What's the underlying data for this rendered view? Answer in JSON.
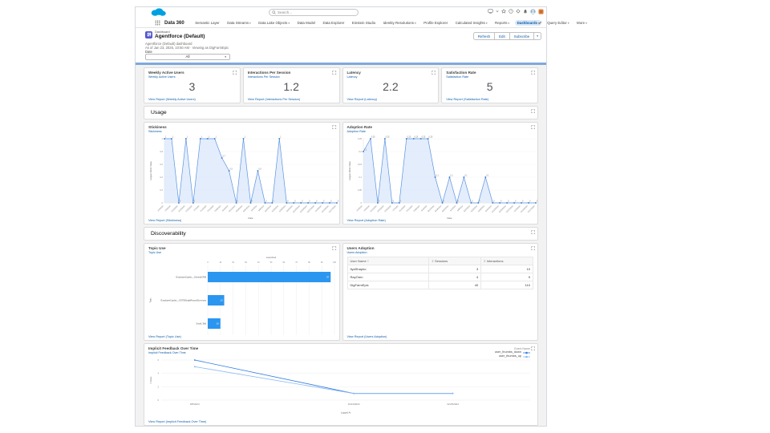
{
  "topbar": {
    "app_name": "Data 360",
    "search_placeholder": "Search...",
    "nav_items": [
      {
        "label": "Semantic Layer",
        "caret": false,
        "active": false
      },
      {
        "label": "Data Streams",
        "caret": true,
        "active": false
      },
      {
        "label": "Data Lake Objects",
        "caret": true,
        "active": false
      },
      {
        "label": "Data Model",
        "caret": false,
        "active": false
      },
      {
        "label": "Data Explorer",
        "caret": false,
        "active": false
      },
      {
        "label": "Einstein Studio",
        "caret": false,
        "active": false
      },
      {
        "label": "Identity Resolutions",
        "caret": true,
        "active": false
      },
      {
        "label": "Profile Explorer",
        "caret": false,
        "active": false
      },
      {
        "label": "Calculated Insights",
        "caret": true,
        "active": false
      },
      {
        "label": "Reports",
        "caret": true,
        "active": false
      },
      {
        "label": "Dashboards",
        "caret": true,
        "active": true
      },
      {
        "label": "Query Editor",
        "caret": true,
        "active": false
      },
      {
        "label": "More",
        "caret": true,
        "active": false
      }
    ],
    "icons": [
      "screenshot-icon",
      "chevron-down-icon",
      "favorites-icon",
      "help-icon",
      "setup-icon",
      "notifications-icon",
      "user-avatar",
      "astro-icon"
    ]
  },
  "header": {
    "type_label": "Dashboard",
    "title": "Agentforce (Default)",
    "subtitle": "Agentforce (Default) dashboard",
    "as_of": "As of Jan 23, 2025, 10:50 AM · Viewing as DigFarmEpic",
    "actions": [
      "Refresh",
      "Edit",
      "Subscribe"
    ],
    "filter": {
      "label": "Date",
      "value": "All"
    }
  },
  "sections": {
    "usage": "Usage",
    "discoverability": "Discoverability"
  },
  "metrics": [
    {
      "title": "Weekly Active Users",
      "subtitle": "Weekly Active Users",
      "value": "3",
      "link": "View Report (Weekly Active Users)"
    },
    {
      "title": "Interactions Per Session",
      "subtitle": "Interactions Per Session",
      "value": "1.2",
      "link": "View Report (Interactions Per Session)"
    },
    {
      "title": "Latency",
      "subtitle": "Latency",
      "value": "2.2",
      "link": "View Report (Latency)"
    },
    {
      "title": "Satisfaction Rate",
      "subtitle": "Satisfaction Rate",
      "value": "5",
      "link": "View Report (Satisfaction Rate)"
    }
  ],
  "chart_data": [
    {
      "id": "stickiness",
      "type": "area",
      "title": "Stickiness",
      "subtitle": "Stickiness",
      "link": "View Report (Stickiness)",
      "xlabel": "Date",
      "ylabel": "Largest Metric Value",
      "ylim": [
        0,
        1
      ],
      "yticks": [
        0,
        0.2,
        0.4,
        0.6,
        0.8,
        1
      ],
      "categories": [
        "6/2/2024",
        "6/9/2024",
        "6/16/2024",
        "6/23/2024",
        "6/30/2024",
        "7/7/2024",
        "7/14/2024",
        "7/21/2024",
        "7/28/2024",
        "8/4/2024",
        "8/11/2024",
        "8/18/2024",
        "8/25/2024",
        "9/1/2024",
        "9/8/2024",
        "9/15/2024",
        "9/22/2024",
        "9/29/2024",
        "10/6/2024",
        "10/13/2024",
        "10/20/2024",
        "10/27/2024",
        "11/3/2024",
        "11/10/2024",
        "11/17/2024"
      ],
      "values": [
        1,
        1,
        0,
        1,
        0,
        1,
        1,
        1,
        0.7,
        0.5,
        0,
        1,
        0,
        0.5,
        0,
        0,
        1,
        0,
        0,
        0,
        0,
        0,
        0,
        0,
        0
      ]
    },
    {
      "id": "adoption_rate",
      "type": "area",
      "title": "Adoption Rate",
      "subtitle": "Adoption Rate",
      "link": "View Report (Adoption Rate)",
      "xlabel": "Date",
      "ylabel": "Largest Metric Value",
      "ylim": [
        0,
        0.25
      ],
      "yticks": [
        0,
        0.05,
        0.1,
        0.15,
        0.2,
        0.25
      ],
      "categories": [
        "6/2/2024",
        "6/9/2024",
        "6/16/2024",
        "6/23/2024",
        "6/30/2024",
        "7/7/2024",
        "7/14/2024",
        "7/21/2024",
        "7/28/2024",
        "8/4/2024",
        "8/11/2024",
        "8/18/2024",
        "8/25/2024",
        "9/1/2024",
        "9/8/2024",
        "9/15/2024",
        "9/22/2024",
        "9/29/2024",
        "10/6/2024",
        "10/13/2024",
        "10/20/2024",
        "10/27/2024",
        "11/3/2024",
        "11/10/2024",
        "11/17/2024"
      ],
      "values": [
        0.2,
        0.25,
        0,
        0.25,
        0,
        0,
        0.25,
        0.25,
        0.25,
        0.25,
        0.1,
        0,
        0.1,
        0,
        0.1,
        0,
        0,
        0.1,
        0,
        0,
        0,
        0,
        0,
        0,
        0
      ]
    },
    {
      "id": "topic_use",
      "type": "bar-h",
      "title": "Topic Use",
      "subtitle": "Topic Use",
      "link": "View Report (Topic Use)",
      "axis_title": "Launched",
      "ylabel": "Topic",
      "xlim": [
        0,
        100
      ],
      "xtick_step": 10,
      "categories": [
        "EmployeeCopilot__GeneralCRM",
        "EmployeeCopilot__OOTBSingleRecordSummary",
        "Small_Talk"
      ],
      "values": [
        97,
        13,
        10
      ]
    },
    {
      "id": "users_adoption",
      "type": "table",
      "title": "Users Adoption",
      "subtitle": "Users Adoption",
      "link": "View Report (Users Adoption)",
      "columns": [
        "User Name",
        "Sessions",
        "Interactions"
      ],
      "sort_indicator": "↑",
      "rows": [
        [
          "IlyaShapiro",
          "3",
          "10"
        ],
        [
          "RayOren",
          "4",
          "9"
        ],
        [
          "DigFarmEpic",
          "40",
          "110"
        ]
      ]
    },
    {
      "id": "implicit_feedback",
      "type": "line",
      "title": "Implicit Feedback Over Time",
      "subtitle": "Implicit Feedback Over Time",
      "link": "View Report (Implicit Feedback Over Time)",
      "xlabel": "Logged At",
      "ylabel": "# Rows",
      "ylim": [
        0,
        6
      ],
      "yticks": [
        0,
        2,
        4,
        6
      ],
      "x": [
        "8/5/2024",
        "10/13/2024",
        "11/25/2024"
      ],
      "legend_title": "Event Name",
      "series": [
        {
          "name": "user_thumbs_down",
          "color": "#2f7de1",
          "values": [
            6,
            1,
            1
          ]
        },
        {
          "name": "user_thumbs_up",
          "color": "#8ab9f2",
          "values": [
            5,
            1,
            1
          ]
        }
      ]
    }
  ],
  "colors": {
    "accent": "#0176d3",
    "link": "#0b5cab",
    "bar": "#2b96f0",
    "area_line": "#5b94e0",
    "area_fill": "#dce9fb",
    "marker": "#3b77c2",
    "header_underline": "#7ea9dd",
    "dashboard_icon": "#5257cf",
    "logo_blue": "#00a1e0"
  }
}
